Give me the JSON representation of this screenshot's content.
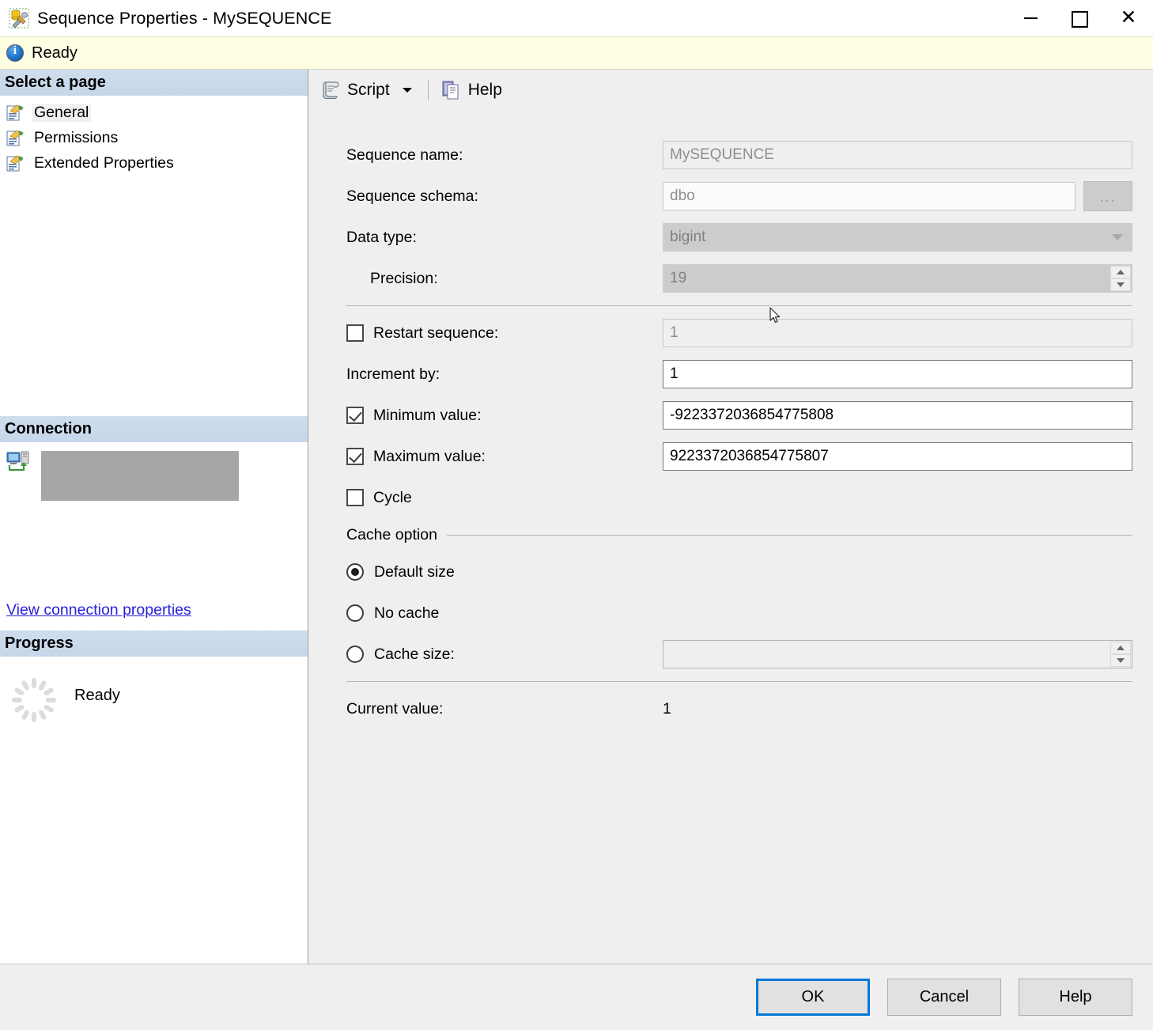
{
  "window": {
    "title": "Sequence Properties - MySEQUENCE",
    "icon": "sequence-properties-icon",
    "controls": {
      "minimize": "—",
      "maximize": "□",
      "close": "✕"
    }
  },
  "status": {
    "icon": "info-icon",
    "text": "Ready"
  },
  "sidebar": {
    "select_page_header": "Select a page",
    "items": [
      {
        "label": "General",
        "selected": true
      },
      {
        "label": "Permissions",
        "selected": false
      },
      {
        "label": "Extended Properties",
        "selected": false
      }
    ],
    "connection": {
      "header": "Connection",
      "server_name": "",
      "link": "View connection properties"
    },
    "progress": {
      "header": "Progress",
      "text": "Ready"
    }
  },
  "toolbar": {
    "script_label": "Script",
    "help_label": "Help"
  },
  "form": {
    "sequence_name": {
      "label": "Sequence name:",
      "value": "MySEQUENCE",
      "enabled": false
    },
    "sequence_schema": {
      "label": "Sequence schema:",
      "value": "dbo",
      "enabled": false,
      "browse": "..."
    },
    "data_type": {
      "label": "Data type:",
      "value": "bigint",
      "enabled": false
    },
    "precision": {
      "label": "Precision:",
      "value": "19",
      "enabled": false
    },
    "restart_sequence": {
      "label": "Restart sequence:",
      "checked": false,
      "value": "1",
      "enabled": false
    },
    "increment_by": {
      "label": "Increment by:",
      "value": "1",
      "enabled": true
    },
    "minimum_value": {
      "label": "Minimum value:",
      "checked": true,
      "value": "-9223372036854775808",
      "enabled": true
    },
    "maximum_value": {
      "label": "Maximum value:",
      "checked": true,
      "value": "9223372036854775807",
      "enabled": true
    },
    "cycle": {
      "label": "Cycle",
      "checked": false
    },
    "cache_option": {
      "group_label": "Cache option",
      "options": [
        {
          "label": "Default size",
          "selected": true
        },
        {
          "label": "No cache",
          "selected": false
        },
        {
          "label": "Cache size:",
          "selected": false
        }
      ],
      "cache_size_value": ""
    },
    "current_value": {
      "label": "Current value:",
      "value": "1"
    }
  },
  "footer": {
    "ok": "OK",
    "cancel": "Cancel",
    "help": "Help"
  },
  "colors": {
    "accent": "#0078d7",
    "link": "#2a21d8",
    "status_bg": "#ffffe4",
    "pane_header": "#c6d7ea"
  }
}
